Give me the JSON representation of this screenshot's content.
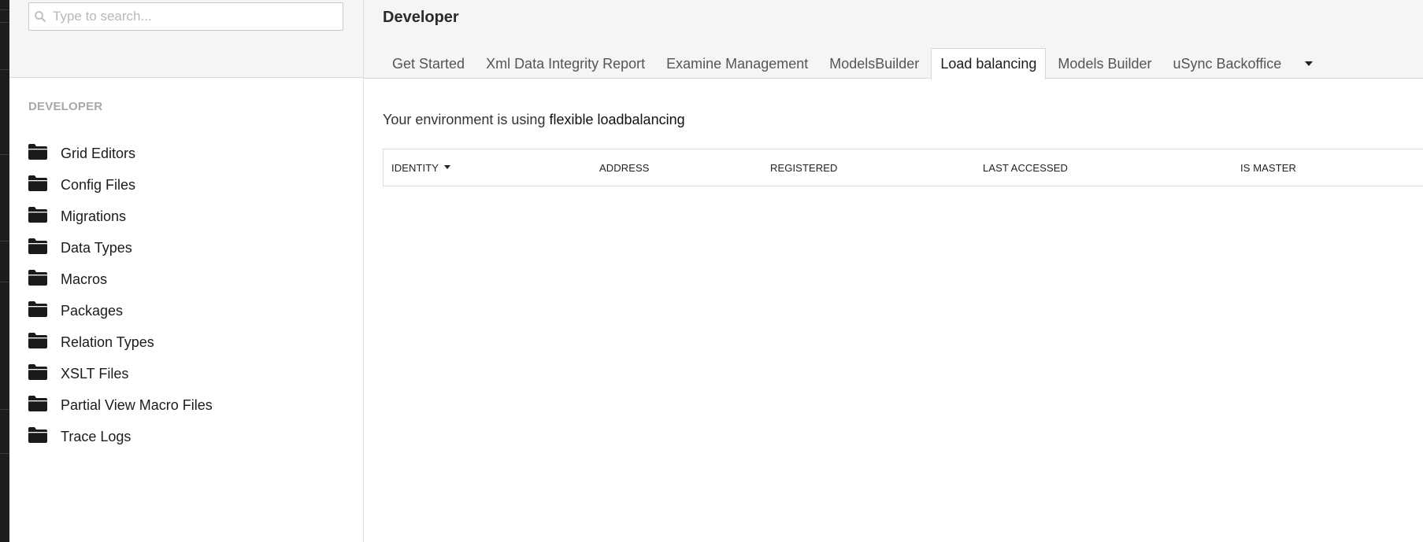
{
  "search": {
    "placeholder": "Type to search..."
  },
  "sidebar": {
    "section_title": "DEVELOPER",
    "items": [
      {
        "label": "Grid Editors",
        "icon": "folder-icon"
      },
      {
        "label": "Config Files",
        "icon": "folder-icon"
      },
      {
        "label": "Migrations",
        "icon": "folder-icon"
      },
      {
        "label": "Data Types",
        "icon": "folder-icon"
      },
      {
        "label": "Macros",
        "icon": "folder-icon"
      },
      {
        "label": "Packages",
        "icon": "folder-icon"
      },
      {
        "label": "Relation Types",
        "icon": "folder-icon"
      },
      {
        "label": "XSLT Files",
        "icon": "folder-icon"
      },
      {
        "label": "Partial View Macro Files",
        "icon": "folder-icon"
      },
      {
        "label": "Trace Logs",
        "icon": "folder-icon"
      }
    ]
  },
  "header": {
    "title": "Developer",
    "tabs": [
      {
        "label": "Get Started",
        "active": false
      },
      {
        "label": "Xml Data Integrity Report",
        "active": false
      },
      {
        "label": "Examine Management",
        "active": false
      },
      {
        "label": "ModelsBuilder",
        "active": false
      },
      {
        "label": "Load balancing",
        "active": true
      },
      {
        "label": "Models Builder",
        "active": false
      },
      {
        "label": "uSync Backoffice",
        "active": false
      }
    ],
    "more_icon": "caret-down-icon"
  },
  "main": {
    "env_prefix": "Your environment is using ",
    "env_mode": "flexible loadbalancing",
    "table": {
      "columns": [
        {
          "label": "IDENTITY",
          "sorted": true
        },
        {
          "label": "ADDRESS",
          "sorted": false
        },
        {
          "label": "REGISTERED",
          "sorted": false
        },
        {
          "label": "LAST ACCESSED",
          "sorted": false
        },
        {
          "label": "IS MASTER",
          "sorted": false
        }
      ],
      "rows": []
    }
  },
  "colors": {
    "chrome_bg": "#f5f5f5",
    "border": "#d8d8d8",
    "section_title": "#a8a8a8",
    "left_strip": "#1d1d1f"
  }
}
